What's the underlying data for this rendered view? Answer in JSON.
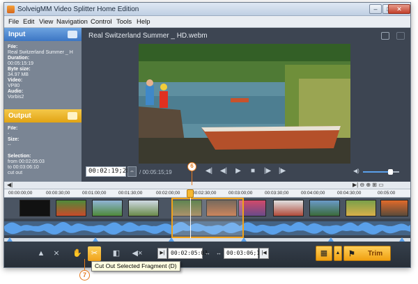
{
  "window": {
    "title": "SolveigMM Video Splitter Home Edition",
    "controls": [
      "–",
      "□",
      "✕"
    ]
  },
  "menu": [
    "File",
    "Edit",
    "View",
    "Navigation",
    "Control",
    "Tools",
    "Help"
  ],
  "input_panel": {
    "header": "Input",
    "fields": [
      {
        "label": "File:",
        "value": "Real Switzerland Summer _ H"
      },
      {
        "label": "Duration:",
        "value": "00:05:15:19"
      },
      {
        "label": "Byte size:",
        "value": "34.97 MB"
      },
      {
        "label": "Video:",
        "value": "VP80"
      },
      {
        "label": "Audio:",
        "value": "Vorbis2"
      }
    ]
  },
  "output_panel": {
    "header": "Output",
    "fields": [
      {
        "label": "File:",
        "value": "-"
      },
      {
        "label": "Size:",
        "value": "--"
      },
      {
        "label": "Selection:",
        "value": ""
      }
    ],
    "selection_from": "from   00:02:05:03",
    "selection_to": "to       00:03:06:10",
    "selection_action": "cut out"
  },
  "viewer": {
    "filename": "Real Switzerland Summer _ HD.webm",
    "current_time": "00:02:19;28",
    "duration": "/ 00:05:15;19",
    "volume_level": 0.75
  },
  "annotations": {
    "marker_a": "6",
    "marker_b": "7"
  },
  "timeline": {
    "ticks": [
      "00:00:00;00",
      "00:00:30;00",
      "00:01:00;00",
      "00:01:30;00",
      "00:02:00;00",
      "00:02:30;00",
      "00:03:00;00",
      "00:03:30;00",
      "00:04:00;00",
      "00:04:30;00",
      "00:05:00"
    ]
  },
  "toolbar": {
    "start_time": "00:02:05:03",
    "end_time": "00:03:06;10",
    "trim_label": "Trim",
    "tooltip": "Cut Out Selected Fragment (D)"
  },
  "colors": {
    "accent_orange": "#f0a21a",
    "input_blue": "#3c76c4",
    "waveform": "#5aa0ea"
  }
}
